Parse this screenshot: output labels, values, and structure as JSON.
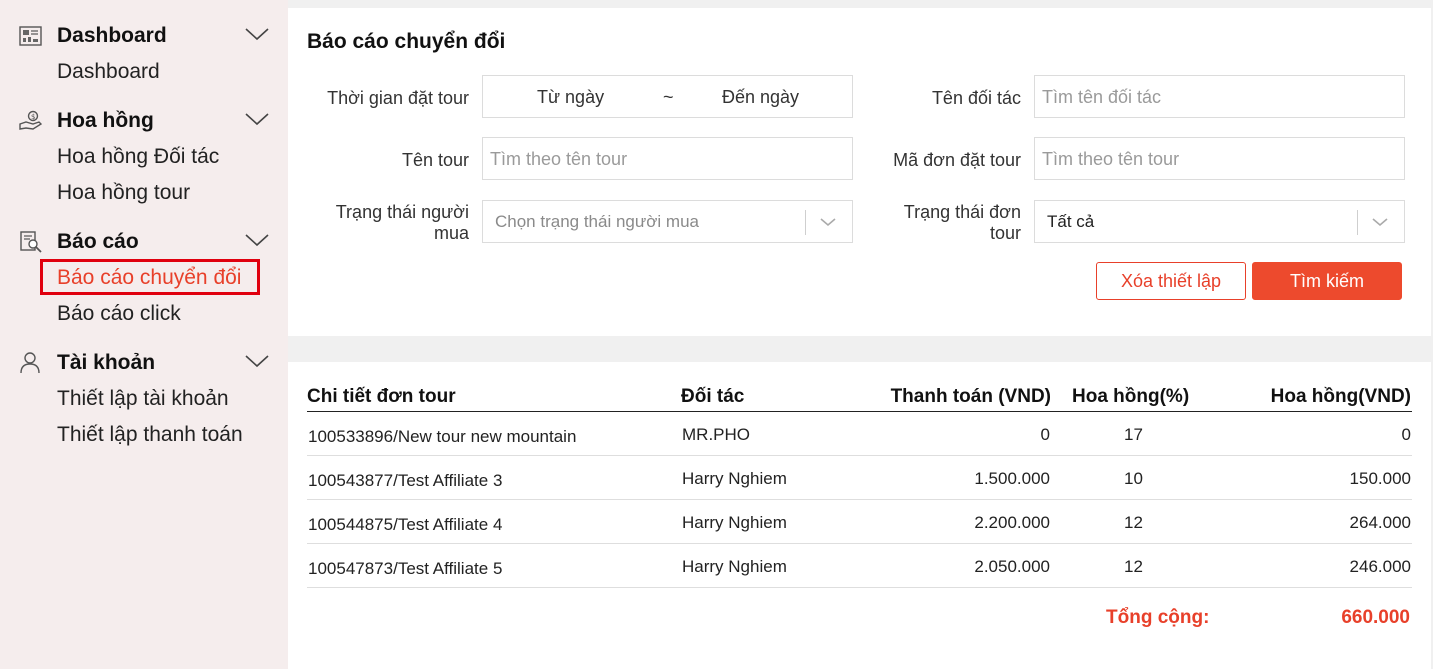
{
  "sidebar": {
    "groups": [
      {
        "icon": "dashboard-icon",
        "title": "Dashboard",
        "items": [
          "Dashboard"
        ]
      },
      {
        "icon": "commission-icon",
        "title": "Hoa hồng",
        "items": [
          "Hoa hồng Đối tác",
          "Hoa hồng tour"
        ]
      },
      {
        "icon": "report-icon",
        "title": "Báo cáo",
        "items": [
          "Báo cáo chuyển đổi",
          "Báo cáo click"
        ]
      },
      {
        "icon": "user-icon",
        "title": "Tài khoản",
        "items": [
          "Thiết lập tài khoản",
          "Thiết lập thanh toán"
        ]
      }
    ],
    "active_item": "Báo cáo chuyển đổi"
  },
  "filters": {
    "title": "Báo cáo chuyển đổi",
    "booking_time": {
      "label": "Thời gian đặt tour",
      "from": "Từ ngày",
      "separator": "~",
      "to": "Đến ngày"
    },
    "partner_name": {
      "label": "Tên đối tác",
      "placeholder": "Tìm tên đối tác"
    },
    "tour_name": {
      "label": "Tên tour",
      "placeholder": "Tìm theo tên tour"
    },
    "order_code": {
      "label": "Mã đơn đặt tour",
      "placeholder": "Tìm theo tên tour"
    },
    "buyer_status": {
      "label_line1": "Trạng thái người",
      "label_line2": "mua",
      "placeholder": "Chọn trạng thái người mua"
    },
    "order_status": {
      "label_line1": "Trạng thái đơn",
      "label_line2": "tour",
      "value": "Tất cả"
    },
    "reset_label": "Xóa thiết lập",
    "search_label": "Tìm kiếm"
  },
  "table": {
    "columns": [
      "Chi tiết đơn tour",
      "Đối tác",
      "Thanh toán (VND)",
      "Hoa hồng(%)",
      "Hoa hồng(VND)"
    ],
    "rows": [
      [
        "100533896/New tour new mountain",
        "MR.PHO",
        "0",
        "17",
        "0"
      ],
      [
        "100543877/Test Affiliate 3",
        "Harry Nghiem",
        "1.500.000",
        "10",
        "150.000"
      ],
      [
        "100544875/Test Affiliate 4",
        "Harry Nghiem",
        "2.200.000",
        "12",
        "264.000"
      ],
      [
        "100547873/Test Affiliate 5",
        "Harry Nghiem",
        "2.050.000",
        "12",
        "246.000"
      ]
    ],
    "total_label": "Tổng cộng:",
    "total_value": "660.000"
  },
  "colors": {
    "accent": "#e8402a",
    "sidebar_bg": "#f5eded",
    "highlight_border": "#e0000e"
  }
}
